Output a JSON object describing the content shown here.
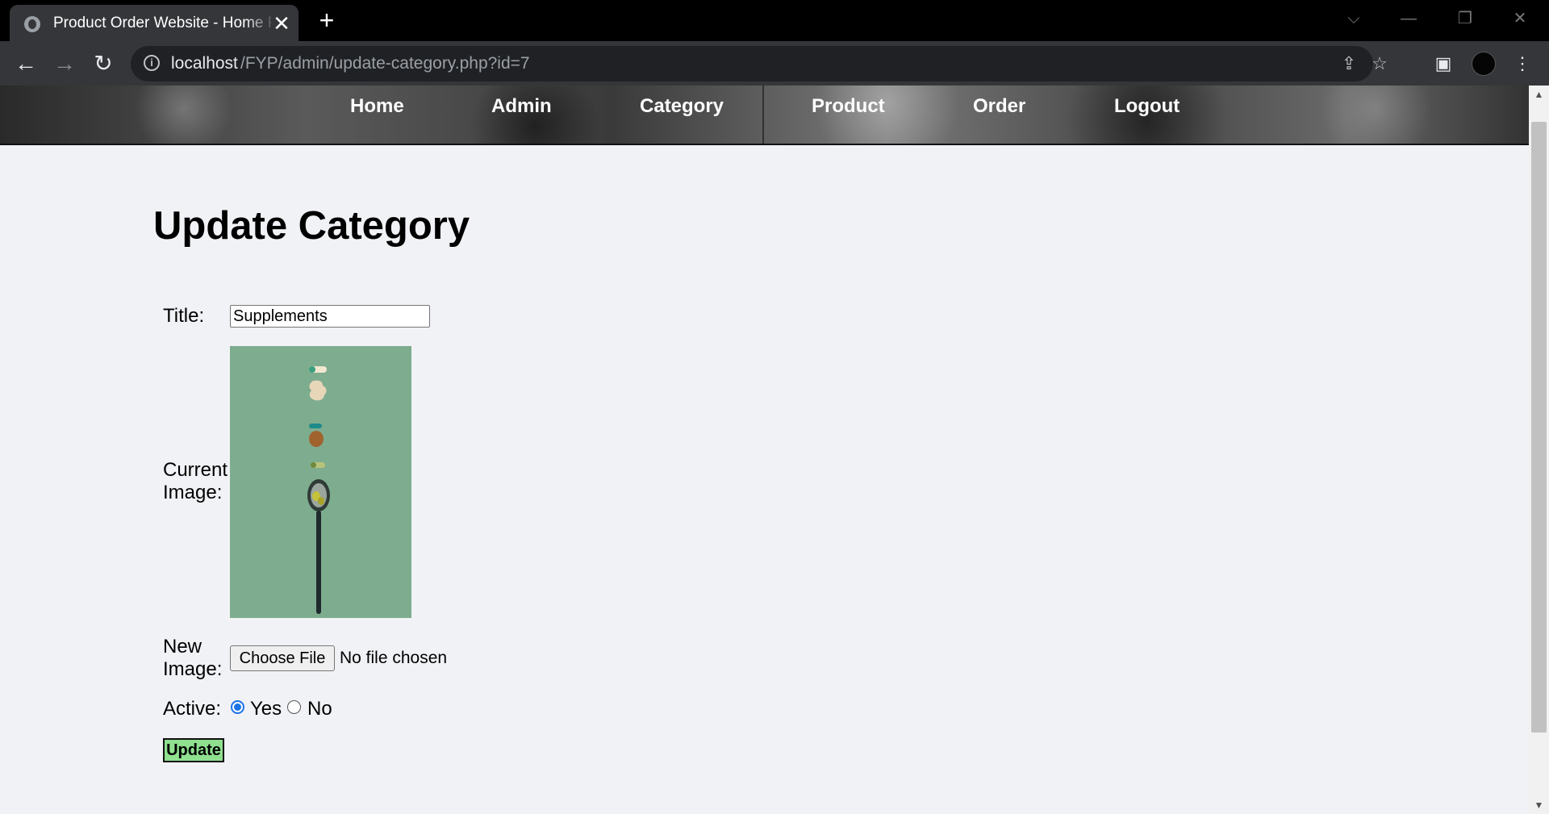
{
  "browser": {
    "tab_title": "Product Order Website - Home Page",
    "tab_close_glyph": "✕",
    "new_tab_glyph": "+",
    "url_host": "localhost",
    "url_path": "/FYP/admin/update-category.php?id=7",
    "icons": [
      "globe-icon",
      "back-icon",
      "forward-icon",
      "reload-icon",
      "info-icon",
      "share-icon",
      "star-icon",
      "side-panel-icon",
      "profile-avatar",
      "menu-icon"
    ]
  },
  "nav": {
    "items": [
      {
        "label": "Home"
      },
      {
        "label": "Admin"
      },
      {
        "label": "Category"
      },
      {
        "label": "Product"
      },
      {
        "label": "Order"
      },
      {
        "label": "Logout"
      }
    ]
  },
  "page": {
    "title": "Update Category"
  },
  "form": {
    "title_label": "Title:",
    "title_value": "Supplements",
    "current_image_label_line1": "Current",
    "current_image_label_line2": "Image:",
    "new_image_label_line1": "New",
    "new_image_label_line2": "Image:",
    "choose_file_label": "Choose File",
    "file_status": "No file chosen",
    "active_label": "Active:",
    "active_options": [
      {
        "label": "Yes",
        "checked": true
      },
      {
        "label": "No",
        "checked": false
      }
    ],
    "submit_label": "Update"
  },
  "colors": {
    "page_bg": "#f1f2f6",
    "update_button_bg": "#8fe08f",
    "radio_accent": "#1a73e8",
    "image_bg": "#7aa98b"
  }
}
